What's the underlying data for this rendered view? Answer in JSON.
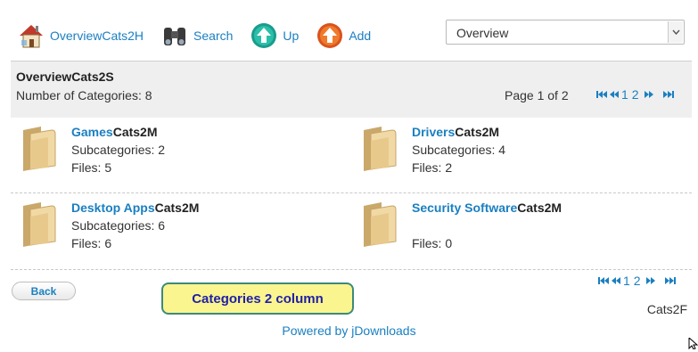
{
  "toolbar": {
    "overview": {
      "label": "Overview",
      "suffix": "Cats2H",
      "icon": "home-icon"
    },
    "search": {
      "label": "Search",
      "icon": "binoculars-icon"
    },
    "up": {
      "label": "Up",
      "icon": "up-arrow-icon"
    },
    "add": {
      "label": "Add",
      "icon": "add-arrow-icon"
    }
  },
  "view_select": {
    "selected": "Overview"
  },
  "header": {
    "title": "OverviewCats2S",
    "count_text": "Number of Categories: 8",
    "page_text": "Page 1 of 2",
    "pager": {
      "page1": "1",
      "page2": "2"
    }
  },
  "categories": [
    {
      "name": "Games",
      "suffix": "Cats2M",
      "subcategories": "Subcategories: 2",
      "files": "Files: 5"
    },
    {
      "name": "Drivers",
      "suffix": "Cats2M",
      "subcategories": "Subcategories: 4",
      "files": "Files: 2"
    },
    {
      "name": "Desktop Apps",
      "suffix": "Cats2M",
      "subcategories": "Subcategories: 6",
      "files": "Files: 6"
    },
    {
      "name": "Security Software",
      "suffix": "Cats2M",
      "subcategories": "",
      "files": "Files: 0"
    }
  ],
  "footer": {
    "back_label": "Back",
    "note": "Categories 2 column",
    "pager": {
      "page1": "1",
      "page2": "2"
    },
    "suffix": "Cats2F",
    "powered": "Powered by jDownloads"
  },
  "colors": {
    "link": "#1a7fc1",
    "band": "#efefef",
    "note_bg": "#fbf58f",
    "note_border": "#3c8a7b"
  }
}
